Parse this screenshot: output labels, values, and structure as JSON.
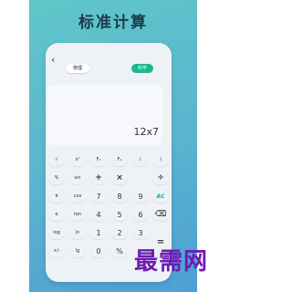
{
  "header": {
    "title": "标准计算"
  },
  "calculator": {
    "back_icon": "‹",
    "tabs": [
      "物理",
      "科学"
    ],
    "display": {
      "expression": "12x7"
    },
    "keys": [
      [
        "√",
        "x²",
        "F₁",
        "F₁",
        "(",
        ")"
      ],
      [
        "%",
        "sin",
        "+",
        "×",
        "÷"
      ],
      [
        "π",
        "cos",
        "7",
        "8",
        "9",
        "AC"
      ],
      [
        "e",
        "tan",
        "4",
        "5",
        "6",
        "⌫"
      ],
      [
        "log",
        "ln",
        "1",
        "2",
        "3",
        "="
      ],
      [
        "+/-",
        "lg",
        "0",
        "%"
      ]
    ]
  },
  "watermark": "最需网",
  "colors": {
    "accent": "#19b88f",
    "watermark": "#6f1bb3"
  }
}
